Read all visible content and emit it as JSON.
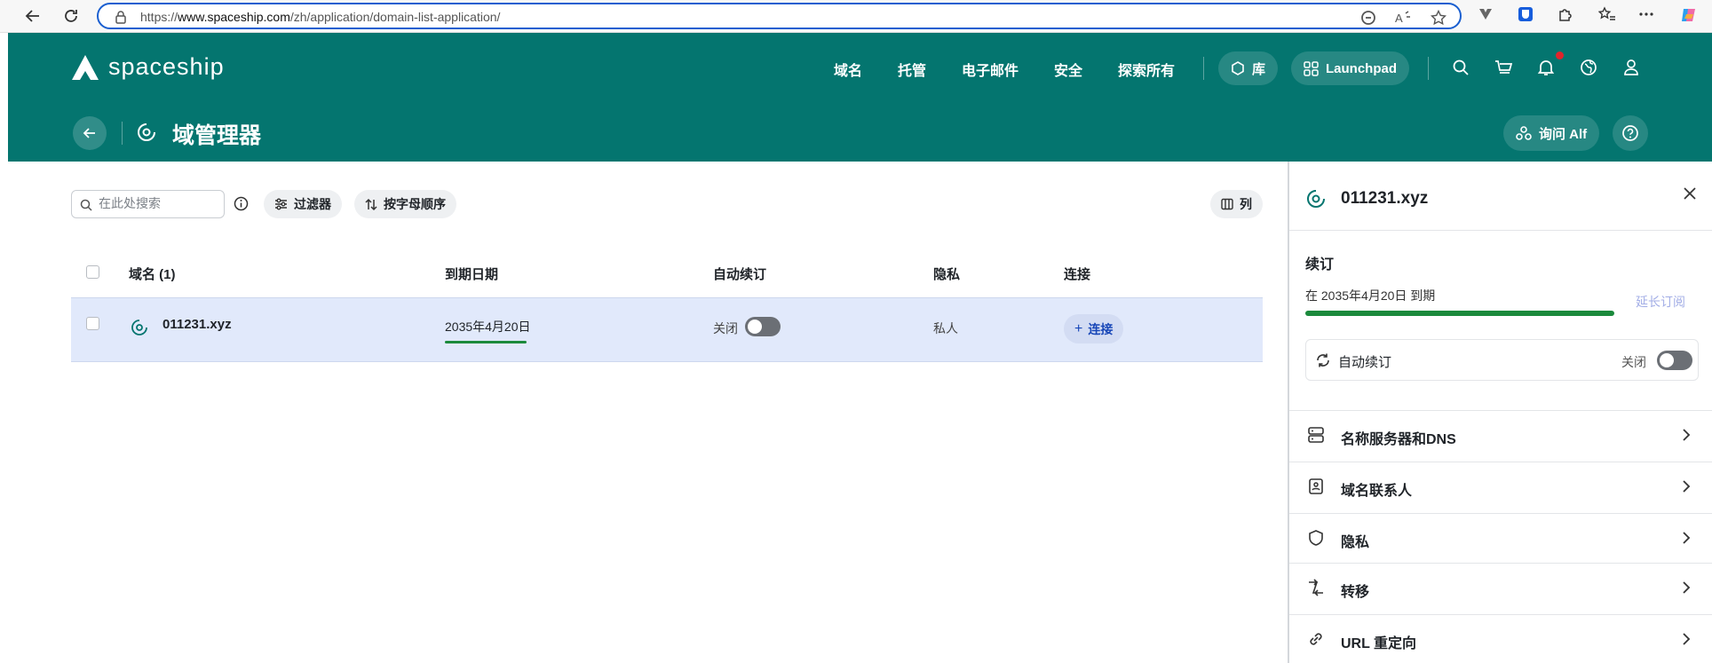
{
  "browser": {
    "url_prefix": "https://",
    "url_host": "www.spaceship.com",
    "url_path": "/zh/application/domain-list-application/"
  },
  "header": {
    "logo_text": "spaceship",
    "nav": [
      "域名",
      "托管",
      "电子邮件",
      "安全",
      "探索所有"
    ],
    "library_label": "库",
    "launchpad_label": "Launchpad",
    "page_title": "域管理器",
    "ask_alf_label": "询问 Alf"
  },
  "toolbar": {
    "search_placeholder": "在此处搜索",
    "filter_label": "过滤器",
    "sort_label": "按字母顺序",
    "columns_label": "列"
  },
  "table": {
    "headers": {
      "domain": "域名 (1)",
      "expiry": "到期日期",
      "autorenew": "自动续订",
      "privacy": "隐私",
      "connect": "连接"
    },
    "rows": [
      {
        "domain": "011231.xyz",
        "expiry": "2035年4月20日",
        "autorenew_state": "关闭",
        "privacy": "私人",
        "connect_label": "连接"
      }
    ]
  },
  "panel": {
    "domain": "011231.xyz",
    "renewal_heading": "续订",
    "expiry_text": "在 2035年4月20日 到期",
    "extend_label": "延长订阅",
    "autorenew_label": "自动续订",
    "autorenew_state": "关闭",
    "items": [
      {
        "label": "名称服务器和DNS"
      },
      {
        "label": "域名联系人"
      },
      {
        "label": "隐私"
      },
      {
        "label": "转移"
      },
      {
        "label": "URL 重定向"
      }
    ]
  },
  "colors": {
    "brand": "#04756f",
    "selected_row": "#e1e9fb",
    "progress": "#1b8a3c",
    "link": "#1847b8"
  }
}
